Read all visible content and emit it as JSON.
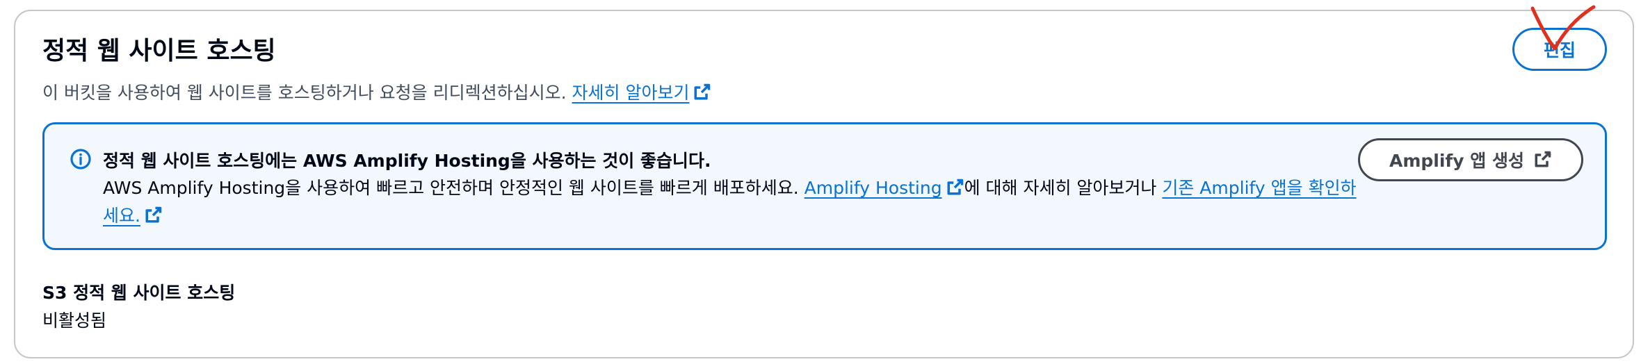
{
  "section": {
    "title": "정적 웹 사이트 호스팅",
    "description": "이 버킷을 사용하여 웹 사이트를 호스팅하거나 요청을 리디렉션하십시오.",
    "learn_more_link": "자세히 알아보기",
    "edit_label": "편집"
  },
  "alert": {
    "title": "정적 웹 사이트 호스팅에는 AWS Amplify Hosting을 사용하는 것이 좋습니다.",
    "body_prefix": "AWS Amplify Hosting을 사용하여 빠르고 안전하며 안정적인 웹 사이트를 빠르게 배포하세요.",
    "link1": "Amplify Hosting",
    "body_middle": "에 대해 자세히 알아보거나",
    "link2": "기존 Amplify 앱을 확인하세요.",
    "button_label": "Amplify 앱 생성"
  },
  "status": {
    "label": "S3 정적 웹 사이트 호스팅",
    "value": "비활성됨"
  },
  "colors": {
    "link": "#0972d3",
    "alert_bg": "#f2f8fd",
    "annotation_mark": "#e0301e"
  },
  "icons": [
    "external-link-icon",
    "info-icon",
    "checkmark-annotation"
  ]
}
